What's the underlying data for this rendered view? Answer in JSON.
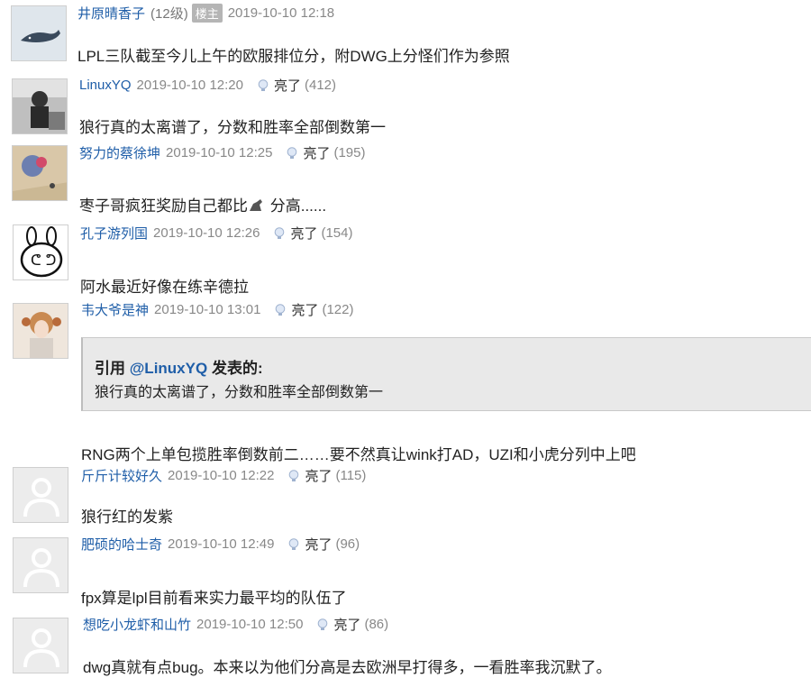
{
  "post": {
    "user": "井原晴香子",
    "level": "(12级)",
    "badge": "楼主",
    "time": "2019-10-10 12:18",
    "content": "LPL三队截至今儿上午的欧服排位分，附DWG上分怪们作为参照"
  },
  "replies": [
    {
      "user": "LinuxYQ",
      "time": "2019-10-10 12:20",
      "light_label": "亮了",
      "count_open": "(",
      "count": "412",
      "count_close": ")",
      "content": "狼行真的太离谱了，分数和胜率全部倒数第一",
      "avatar_icon": "photo-avatar-icon"
    },
    {
      "user": "努力的蔡徐坤",
      "time": "2019-10-10 12:25",
      "light_label": "亮了",
      "count_open": "(",
      "count": "195",
      "count_close": ")",
      "content_pre": "枣子哥疯狂奖励自己都比",
      "content_post": " 分高......",
      "inline_emoji": "horse-emoji-icon",
      "avatar_icon": "photo-avatar-icon"
    },
    {
      "user": "孔子游列国",
      "time": "2019-10-10 12:26",
      "light_label": "亮了",
      "count_open": "(",
      "count": "154",
      "count_close": ")",
      "content": "阿水最近好像在练辛德拉",
      "avatar_icon": "cartoon-rabbit-avatar-icon"
    },
    {
      "user": "韦大爷是神",
      "time": "2019-10-10 13:01",
      "light_label": "亮了",
      "count_open": "(",
      "count": "122",
      "count_close": ")",
      "quote_prefix": "引用 ",
      "quote_user": "@LinuxYQ",
      "quote_suffix": " 发表的:",
      "quote_text": "狼行真的太离谱了，分数和胜率全部倒数第一",
      "content": "RNG两个上单包揽胜率倒数前二……要不然真让wink打AD，UZI和小虎分列中上吧",
      "avatar_icon": "anime-avatar-icon"
    },
    {
      "user": "斤斤计较好久",
      "time": "2019-10-10 12:22",
      "light_label": "亮了",
      "count_open": "(",
      "count": "115",
      "count_close": ")",
      "content": "狼行红的发紫",
      "avatar_icon": "default-user-avatar-icon"
    },
    {
      "user": "肥硕的哈士奇",
      "time": "2019-10-10 12:49",
      "light_label": "亮了",
      "count_open": "(",
      "count": "96",
      "count_close": ")",
      "content": "fpx算是lpl目前看来实力最平均的队伍了",
      "avatar_icon": "default-user-avatar-icon"
    },
    {
      "user": "想吃小龙虾和山竹",
      "time": "2019-10-10 12:50",
      "light_label": "亮了",
      "count_open": "(",
      "count": "86",
      "count_close": ")",
      "content": "dwg真就有点bug。本来以为他们分高是去欧洲早打得多，一看胜率我沉默了。",
      "avatar_icon": "default-user-avatar-icon"
    }
  ],
  "colors": {
    "link": "#1f5ea8",
    "meta": "#888888",
    "quote_bg": "#e9e9e9",
    "page_bg": "#f5f5f5"
  }
}
